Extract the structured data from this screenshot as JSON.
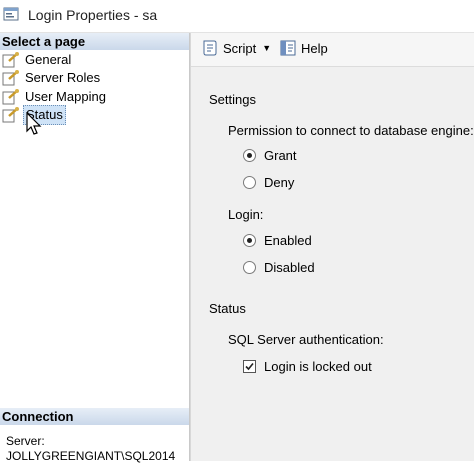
{
  "window": {
    "title": "Login Properties - sa"
  },
  "sidebar": {
    "header": "Select a page",
    "items": [
      {
        "label": "General",
        "selected": false
      },
      {
        "label": "Server Roles",
        "selected": false
      },
      {
        "label": "User Mapping",
        "selected": false
      },
      {
        "label": "Status",
        "selected": true
      }
    ],
    "connection_header": "Connection",
    "server_label": "Server:",
    "server_value": "JOLLYGREENGIANT\\SQL2014"
  },
  "toolbar": {
    "script_label": "Script",
    "help_label": "Help"
  },
  "settings": {
    "title": "Settings",
    "permission_label": "Permission to connect to database engine:",
    "permission_options": [
      {
        "label": "Grant",
        "checked": true
      },
      {
        "label": "Deny",
        "checked": false
      }
    ],
    "login_label": "Login:",
    "login_options": [
      {
        "label": "Enabled",
        "checked": true
      },
      {
        "label": "Disabled",
        "checked": false
      }
    ]
  },
  "status": {
    "title": "Status",
    "auth_label": "SQL Server authentication:",
    "locked_label": "Login is locked out",
    "locked_checked": true
  },
  "colors": {
    "section_header_top": "#e7eef7",
    "section_header_bottom": "#cad8ea",
    "selection": "#cfe3f7",
    "panel_bg": "#f0f0f0"
  }
}
